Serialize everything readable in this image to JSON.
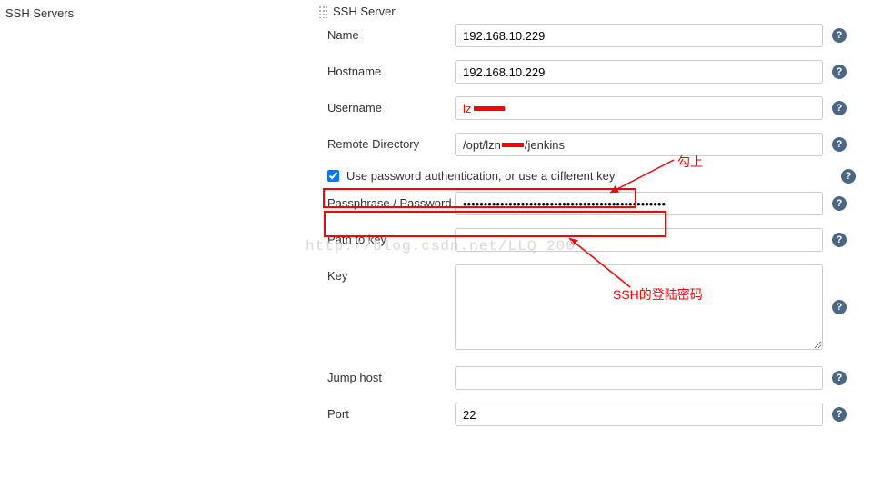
{
  "leftLabel": "SSH Servers",
  "sectionTitle": "SSH Server",
  "fields": {
    "name": {
      "label": "Name",
      "value": "192.168.10.229"
    },
    "hostname": {
      "label": "Hostname",
      "value": "192.168.10.229"
    },
    "username": {
      "label": "Username",
      "value": "lz",
      "redactedSuffix": ""
    },
    "remoteDir": {
      "label": "Remote Directory",
      "value": "/opt/lzn",
      "redactedMiddle": "",
      "valueSuffix": "/jenkins"
    },
    "passwordAuth": {
      "label": "Use password authentication, or use a different key",
      "checked": true
    },
    "passphrase": {
      "label": "Passphrase / Password",
      "value": "•••••••••••••••••••••••••••••••••••••••••••••••••"
    },
    "pathToKey": {
      "label": "Path to key",
      "value": ""
    },
    "key": {
      "label": "Key",
      "value": ""
    },
    "jumpHost": {
      "label": "Jump host",
      "value": ""
    },
    "port": {
      "label": "Port",
      "value": "22"
    }
  },
  "annotations": {
    "ann1": "勾上",
    "ann2": "SSH的登陆密码"
  },
  "watermark": "http://blog.csdn.net/LLQ_200",
  "helpGlyph": "?"
}
